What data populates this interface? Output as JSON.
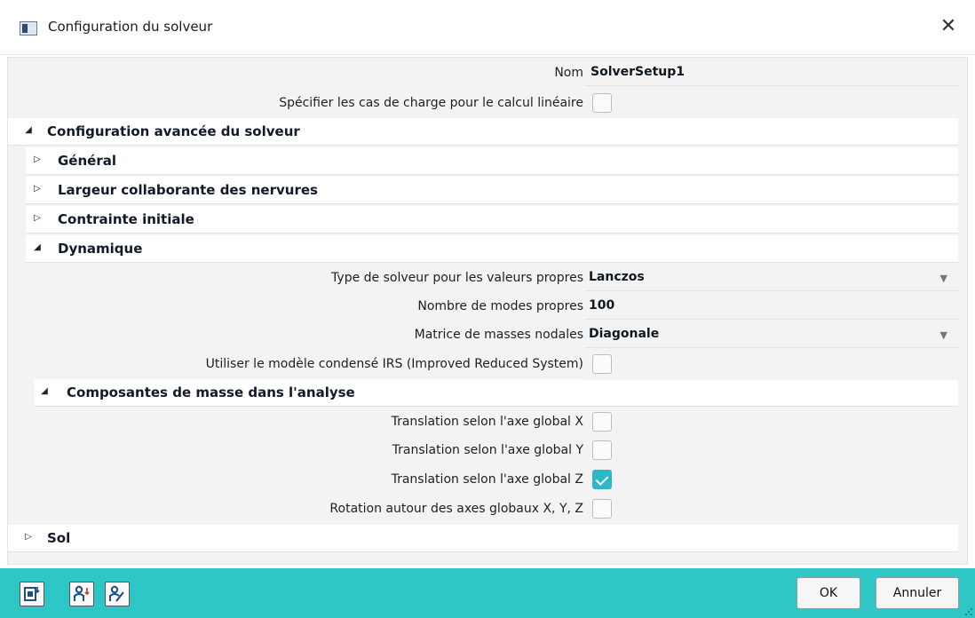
{
  "window": {
    "title": "Configuration du solveur",
    "close": "✕"
  },
  "props": {
    "nom_label": "Nom",
    "nom_value": "SolverSetup1",
    "load_cases_label": "Spécifier les cas de charge pour le calcul linéaire",
    "load_cases_checked": false
  },
  "advanced": {
    "label": "Configuration avancée du solveur",
    "general": "Général",
    "rib_width": "Largeur collaborante des nervures",
    "initial_stress": "Contrainte initiale",
    "dynamics": {
      "label": "Dynamique",
      "eigen_solver_label": "Type de solveur pour les valeurs propres",
      "eigen_solver_value": "Lanczos",
      "num_modes_label": "Nombre de modes propres",
      "num_modes_value": "100",
      "mass_matrix_label": "Matrice de masses nodales",
      "mass_matrix_value": "Diagonale",
      "irs_label": "Utiliser le modèle condensé IRS (Improved Reduced System)",
      "irs_checked": false,
      "mass_components": {
        "label": "Composantes de masse dans l'analyse",
        "tx_label": "Translation selon l'axe global X",
        "tx_checked": false,
        "ty_label": "Translation selon l'axe global Y",
        "ty_checked": false,
        "tz_label": "Translation selon l'axe global Z",
        "tz_checked": true,
        "rot_label": "Rotation autour des axes globaux X, Y, Z",
        "rot_checked": false
      }
    },
    "soil": "Sol"
  },
  "footer": {
    "ok": "OK",
    "cancel": "Annuler"
  },
  "colors": {
    "accent": "#2fc7c5",
    "check": "#2eb7c7"
  }
}
